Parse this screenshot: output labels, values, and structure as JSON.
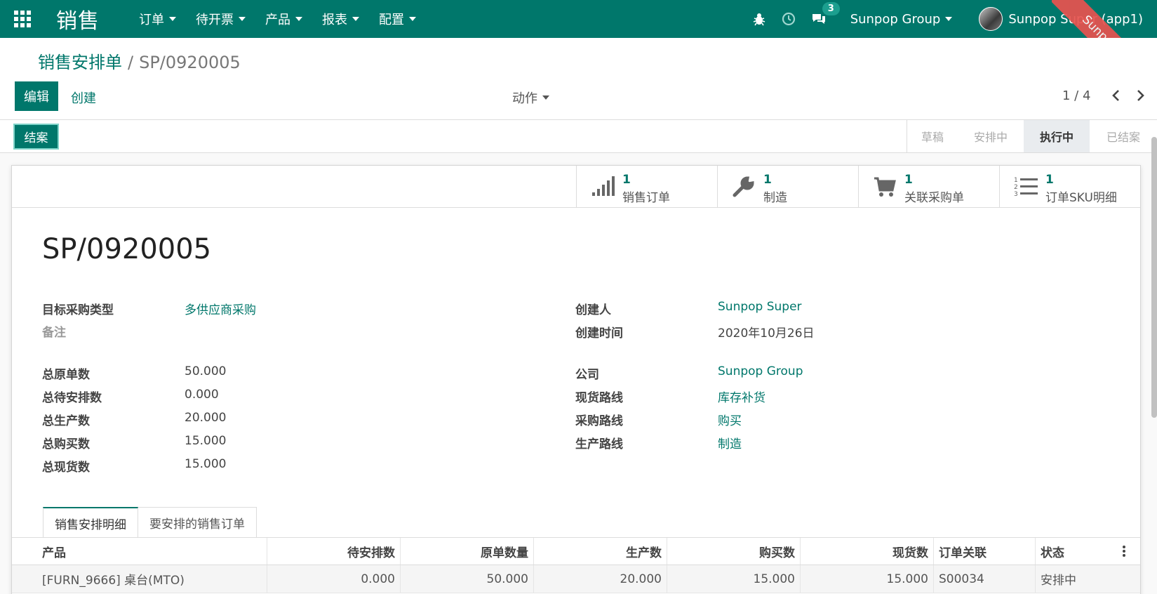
{
  "navbar": {
    "app_name": "销售",
    "menus": [
      {
        "label": "订单"
      },
      {
        "label": "待开票"
      },
      {
        "label": "产品"
      },
      {
        "label": "报表"
      },
      {
        "label": "配置"
      }
    ],
    "message_count": "3",
    "company": "Sunpop Group",
    "user": "Sunpop Super (app1)",
    "accent_color": "#00776b"
  },
  "ribbon": {
    "text": "Sunpop.cn"
  },
  "breadcrumb": {
    "parent": "销售安排单",
    "separator": "/",
    "current": "SP/0920005"
  },
  "control": {
    "edit_label": "编辑",
    "create_label": "创建",
    "action_label": "动作",
    "pager": "1 / 4"
  },
  "statusbar": {
    "close_label": "结案",
    "stages": [
      {
        "label": "草稿",
        "active": false
      },
      {
        "label": "安排中",
        "active": false
      },
      {
        "label": "执行中",
        "active": true
      },
      {
        "label": "已结案",
        "active": false
      }
    ]
  },
  "smart_buttons": [
    {
      "value": "1",
      "label": "销售订单",
      "icon": "signal-bars-icon"
    },
    {
      "value": "1",
      "label": "制造",
      "icon": "wrench-icon"
    },
    {
      "value": "1",
      "label": "关联采购单",
      "icon": "cart-icon"
    },
    {
      "value": "1",
      "label": "订单SKU明细",
      "icon": "numbered-list-icon"
    }
  ],
  "record": {
    "title": "SP/0920005",
    "left_fields_top": [
      {
        "label": "目标采购类型",
        "value": "多供应商采购",
        "link": true
      },
      {
        "label": "备注",
        "value": "",
        "link": false
      }
    ],
    "left_fields_bottom": [
      {
        "label": "总原单数",
        "value": "50.000"
      },
      {
        "label": "总待安排数",
        "value": "0.000"
      },
      {
        "label": "总生产数",
        "value": "20.000"
      },
      {
        "label": "总购买数",
        "value": "15.000"
      },
      {
        "label": "总现货数",
        "value": "15.000"
      }
    ],
    "right_fields_top": [
      {
        "label": "创建人",
        "value": "Sunpop Super",
        "link": true
      },
      {
        "label": "创建时间",
        "value": "2020年10月26日",
        "link": false
      }
    ],
    "right_fields_bottom": [
      {
        "label": "公司",
        "value": "Sunpop Group"
      },
      {
        "label": "现货路线",
        "value": "库存补货"
      },
      {
        "label": "采购路线",
        "value": "购买"
      },
      {
        "label": "生产路线",
        "value": "制造"
      }
    ]
  },
  "tabs": [
    {
      "label": "销售安排明细",
      "active": true
    },
    {
      "label": "要安排的销售订单",
      "active": false
    }
  ],
  "table": {
    "columns": [
      "产品",
      "待安排数",
      "原单数量",
      "生产数",
      "购买数",
      "现货数",
      "订单关联",
      "状态"
    ],
    "rows": [
      [
        "[FURN_9666] 桌台(MTO)",
        "0.000",
        "50.000",
        "20.000",
        "15.000",
        "15.000",
        "S00034",
        "安排中"
      ]
    ]
  }
}
